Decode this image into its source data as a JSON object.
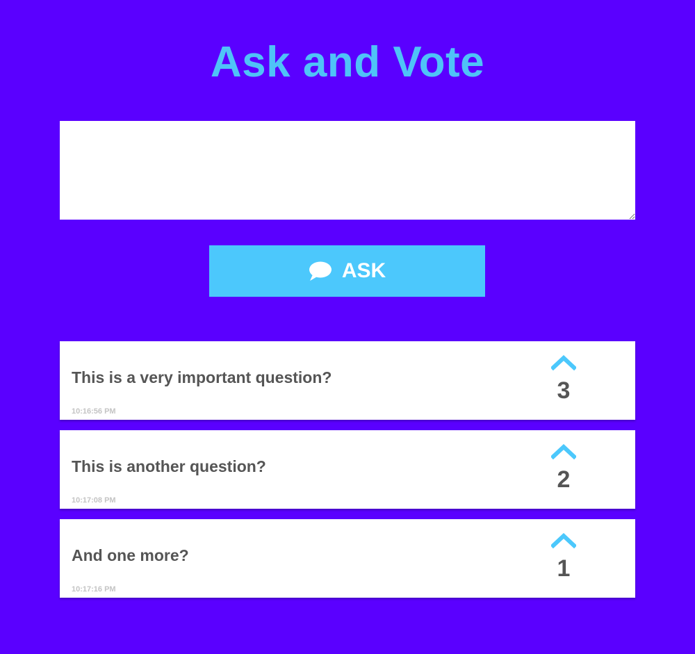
{
  "header": {
    "title": "Ask and Vote"
  },
  "form": {
    "input_value": "",
    "input_placeholder": "",
    "ask_label": "ASK",
    "ask_icon": "speech-bubble-icon"
  },
  "questions": [
    {
      "text": "This is a very important question?",
      "time": "10:16:56 PM",
      "votes": "3"
    },
    {
      "text": "This is another question?",
      "time": "10:17:08 PM",
      "votes": "2"
    },
    {
      "text": "And one more?",
      "time": "10:17:16 PM",
      "votes": "1"
    }
  ],
  "colors": {
    "background": "#5a00ff",
    "accent": "#4cc8fc",
    "title": "#4fc3f7",
    "text": "#555555",
    "timestamp": "#c4c4c4"
  }
}
